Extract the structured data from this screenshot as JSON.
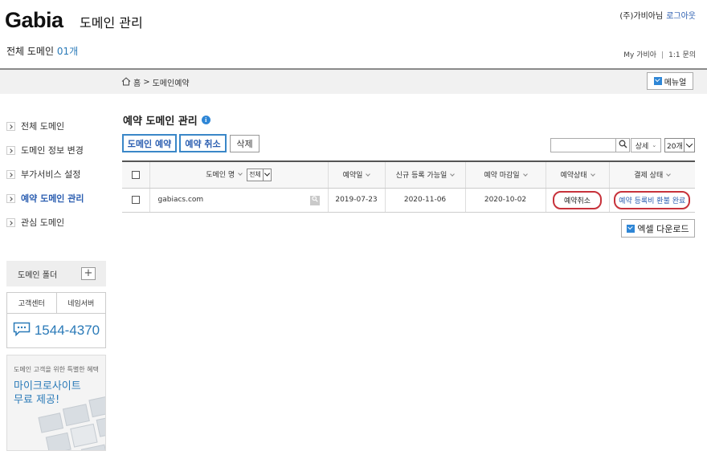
{
  "header": {
    "logo": "Gabia",
    "app_title": "도메인 관리",
    "user_name": "(주)가비아님",
    "logout": "로그아웃",
    "domain_count_label": "전체 도메인",
    "domain_count": "01개",
    "links": [
      "My 가비아",
      "1:1 문의"
    ]
  },
  "breadcrumb": {
    "home": "홈",
    "separator": ">",
    "current": "도메인예약",
    "manual_button": "메뉴얼"
  },
  "sidebar": {
    "items": [
      {
        "label": "전체 도메인",
        "active": false
      },
      {
        "label": "도메인 정보 변경",
        "active": false
      },
      {
        "label": "부가서비스 설정",
        "active": false
      },
      {
        "label": "예약 도메인 관리",
        "active": true
      },
      {
        "label": "관심 도메인",
        "active": false
      }
    ],
    "folder_label": "도메인 폴더",
    "folder_add": "+",
    "contact_tabs": [
      "고객센터",
      "네임서버"
    ],
    "phone": "1544-4370",
    "promo_sub": "도메인 고객을 위한 특별한 혜택",
    "promo_title_line1": "마이크로사이트",
    "promo_title_line2": "무료 제공!"
  },
  "main": {
    "title": "예약 도메인 관리",
    "info_icon": "i",
    "buttons": {
      "reserve": "도메인 예약",
      "cancel": "예약 취소",
      "delete": "삭제"
    },
    "search": {
      "placeholder": "",
      "detail": "상세",
      "per_page": "20개"
    },
    "table": {
      "headers": [
        "도메인 명",
        "예약일",
        "신규 등록 가능일",
        "예약 마감일",
        "예약상태",
        "결제 상태"
      ],
      "domain_filter": "전체",
      "rows": [
        {
          "domain": "gabiacs.com",
          "reserved_date": "2019-07-23",
          "available_date": "2020-11-06",
          "deadline": "2020-10-02",
          "status": "예약취소",
          "payment": "예약 등록비 환불 완료"
        }
      ]
    },
    "excel_button": "엑셀 다운로드"
  },
  "colors": {
    "accent": "#2a7ab8",
    "link": "#2a5db0",
    "highlight_circle": "#c7323b",
    "icon_blue": "#2e86d6"
  }
}
